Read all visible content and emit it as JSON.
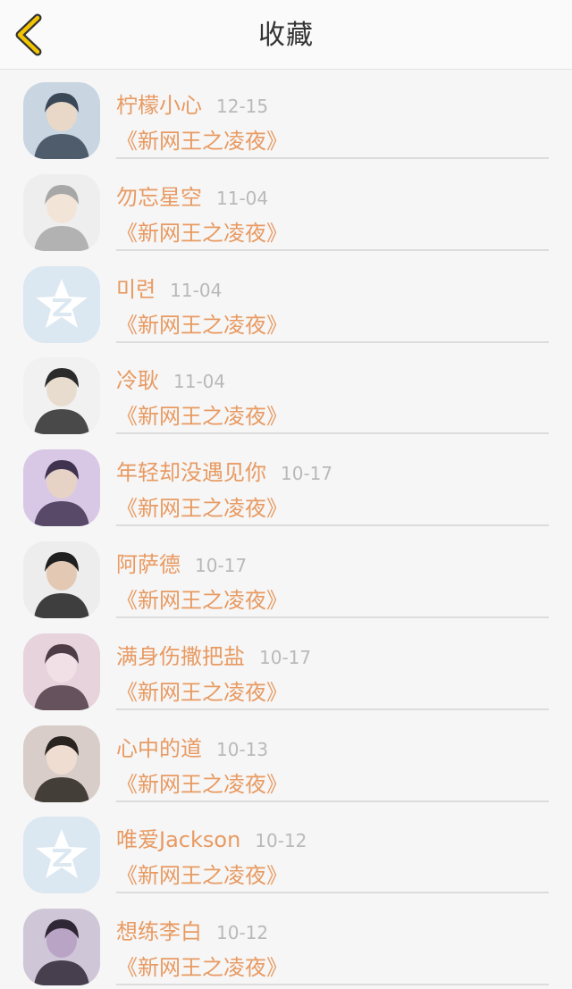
{
  "header": {
    "title": "收藏",
    "back_icon": "chevron-left-icon",
    "accent": "#f2c500"
  },
  "theme": {
    "name_color": "#e89a62",
    "date_color": "#b9b9b9"
  },
  "favorites": [
    {
      "name": "柠檬小心",
      "date": "12-15",
      "novel": "《新网王之凌夜》",
      "avatar": "photo"
    },
    {
      "name": "勿忘星空",
      "date": "11-04",
      "novel": "《新网王之凌夜》",
      "avatar": "photo"
    },
    {
      "name": "미련",
      "date": "11-04",
      "novel": "《新网王之凌夜》",
      "avatar": "qq-default"
    },
    {
      "name": "冷耿",
      "date": "11-04",
      "novel": "《新网王之凌夜》",
      "avatar": "photo"
    },
    {
      "name": "年轻却没遇见你",
      "date": "10-17",
      "novel": "《新网王之凌夜》",
      "avatar": "photo"
    },
    {
      "name": "阿萨德",
      "date": "10-17",
      "novel": "《新网王之凌夜》",
      "avatar": "photo"
    },
    {
      "name": "满身伤撒把盐",
      "date": "10-17",
      "novel": "《新网王之凌夜》",
      "avatar": "photo"
    },
    {
      "name": "心中的道",
      "date": "10-13",
      "novel": "《新网王之凌夜》",
      "avatar": "photo"
    },
    {
      "name": "唯爱Jackson",
      "date": "10-12",
      "novel": "《新网王之凌夜》",
      "avatar": "qq-default"
    },
    {
      "name": "想练李白",
      "date": "10-12",
      "novel": "《新网王之凌夜》",
      "avatar": "photo"
    }
  ]
}
